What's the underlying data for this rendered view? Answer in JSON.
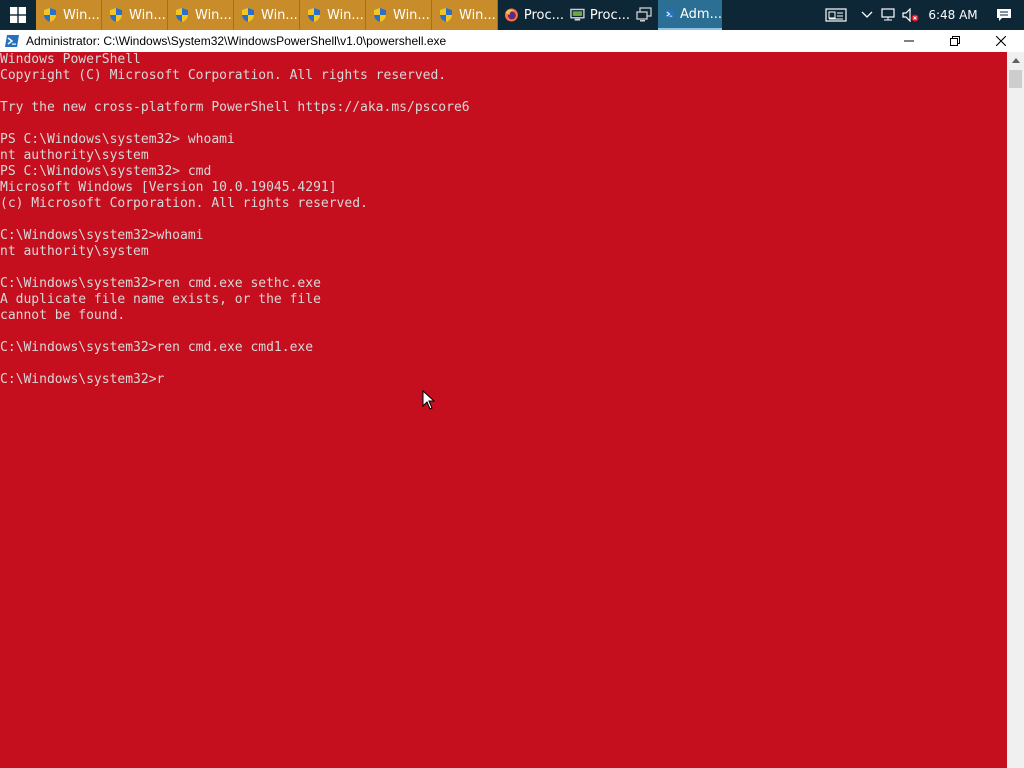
{
  "taskbar": {
    "buttons": [
      {
        "label": "Win...",
        "icon": "shield-icon"
      },
      {
        "label": "Win...",
        "icon": "shield-icon"
      },
      {
        "label": "Win...",
        "icon": "shield-icon"
      },
      {
        "label": "Win...",
        "icon": "shield-icon"
      },
      {
        "label": "Win...",
        "icon": "shield-icon"
      },
      {
        "label": "Win...",
        "icon": "shield-icon"
      },
      {
        "label": "Win...",
        "icon": "shield-icon"
      },
      {
        "label": "Proc...",
        "icon": "firefox-icon"
      },
      {
        "label": "Proc...",
        "icon": "monitor-icon"
      },
      {
        "label": "",
        "icon": "remote-desktop-icon"
      },
      {
        "label": "Adm...",
        "icon": "powershell-icon"
      }
    ],
    "clock": "6:48 AM"
  },
  "window": {
    "title": "Administrator: C:\\Windows\\System32\\WindowsPowerShell\\v1.0\\powershell.exe"
  },
  "console": {
    "lines": [
      "Windows PowerShell",
      "Copyright (C) Microsoft Corporation. All rights reserved.",
      "",
      "Try the new cross-platform PowerShell https://aka.ms/pscore6",
      "",
      "PS C:\\Windows\\system32> whoami",
      "nt authority\\system",
      "PS C:\\Windows\\system32> cmd",
      "Microsoft Windows [Version 10.0.19045.4291]",
      "(c) Microsoft Corporation. All rights reserved.",
      "",
      "C:\\Windows\\system32>whoami",
      "nt authority\\system",
      "",
      "C:\\Windows\\system32>ren cmd.exe sethc.exe",
      "A duplicate file name exists, or the file",
      "cannot be found.",
      "",
      "C:\\Windows\\system32>ren cmd.exe cmd1.exe",
      "",
      "C:\\Windows\\system32>r"
    ]
  },
  "colors": {
    "console_bg": "#c50f1f",
    "console_text": "#d8d8d8",
    "taskbar_bg": "#0e2736",
    "taskbar_window_button": "#c88d2a",
    "taskbar_active": "#2b6f95"
  }
}
